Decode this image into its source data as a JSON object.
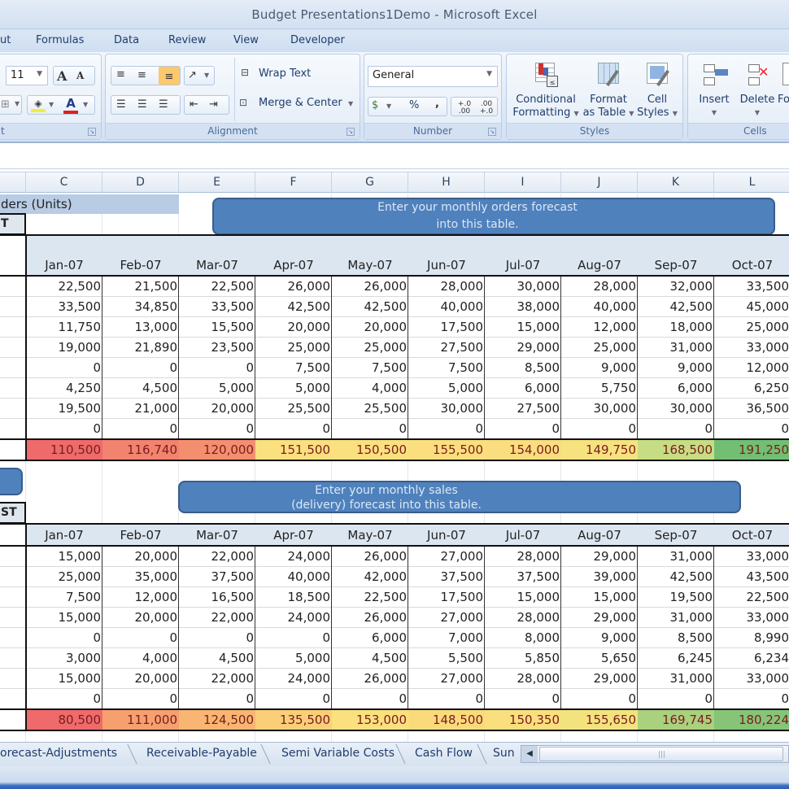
{
  "window": {
    "title": "Budget Presentations1Demo - Microsoft Excel"
  },
  "menu": {
    "tabs": [
      {
        "label": "ut"
      },
      {
        "label": "Formulas"
      },
      {
        "label": "Data"
      },
      {
        "label": "Review"
      },
      {
        "label": "View"
      },
      {
        "label": "Developer"
      }
    ]
  },
  "ribbon": {
    "font": {
      "size_value": "11",
      "group_label_partial": "t",
      "grow_icon": "A",
      "shrink_icon": "A",
      "font_color_icon": "A"
    },
    "alignment": {
      "group_label": "Alignment",
      "wrap_text": "Wrap Text",
      "merge_center": "Merge & Center"
    },
    "number": {
      "group_label": "Number",
      "format_value": "General",
      "percent": "%",
      "comma": ",",
      "inc_decimal": "+.0 .00",
      "dec_decimal": ".00 +.0"
    },
    "styles": {
      "group_label": "Styles",
      "conditional_formatting": [
        "Conditional",
        "Formatting"
      ],
      "format_as_table": [
        "Format",
        "as Table"
      ],
      "cell_styles": [
        "Cell",
        "Styles"
      ]
    },
    "cells": {
      "group_label": "Cells",
      "insert": "Insert",
      "delete": "Delete",
      "format_partial": "Fo"
    }
  },
  "columns": [
    "C",
    "D",
    "E",
    "F",
    "G",
    "H",
    "I",
    "J",
    "K",
    "L"
  ],
  "orders": {
    "title_partial": "ders (Units)",
    "tag_partial": "T",
    "callout": [
      "Enter your monthly  orders forecast",
      "into this table."
    ],
    "months": [
      "Jan-07",
      "Feb-07",
      "Mar-07",
      "Apr-07",
      "May-07",
      "Jun-07",
      "Jul-07",
      "Aug-07",
      "Sep-07",
      "Oct-07"
    ],
    "rows": [
      [
        "22,500",
        "21,500",
        "22,500",
        "26,000",
        "26,000",
        "28,000",
        "30,000",
        "28,000",
        "32,000",
        "33,500"
      ],
      [
        "33,500",
        "34,850",
        "33,500",
        "42,500",
        "42,500",
        "40,000",
        "38,000",
        "40,000",
        "42,500",
        "45,000"
      ],
      [
        "11,750",
        "13,000",
        "15,500",
        "20,000",
        "20,000",
        "17,500",
        "15,000",
        "12,000",
        "18,000",
        "25,000"
      ],
      [
        "19,000",
        "21,890",
        "23,500",
        "25,000",
        "25,000",
        "27,500",
        "29,000",
        "25,000",
        "31,000",
        "33,000"
      ],
      [
        "0",
        "0",
        "0",
        "7,500",
        "7,500",
        "7,500",
        "8,500",
        "9,000",
        "9,000",
        "12,000"
      ],
      [
        "4,250",
        "4,500",
        "5,000",
        "5,000",
        "4,000",
        "5,000",
        "6,000",
        "5,750",
        "6,000",
        "6,250"
      ],
      [
        "19,500",
        "21,000",
        "20,000",
        "25,500",
        "25,500",
        "30,000",
        "27,500",
        "30,000",
        "30,000",
        "36,500"
      ],
      [
        "0",
        "0",
        "0",
        "0",
        "0",
        "0",
        "0",
        "0",
        "0",
        "0"
      ]
    ],
    "totals": [
      "110,500",
      "116,740",
      "120,000",
      "151,500",
      "150,500",
      "155,500",
      "154,000",
      "149,750",
      "168,500",
      "191,250"
    ],
    "total_colors": [
      "#ef6a6b",
      "#f2836e",
      "#f38f6f",
      "#fbe07f",
      "#fbe07f",
      "#fbdf7e",
      "#fadd7f",
      "#f7e280",
      "#c7dd83",
      "#72bf73"
    ],
    "total_text_color": "#7a1d1d"
  },
  "sales": {
    "tag_partial": "ST",
    "callout": [
      "Enter your monthly sales",
      "(delivery) forecast into this table."
    ],
    "months": [
      "Jan-07",
      "Feb-07",
      "Mar-07",
      "Apr-07",
      "May-07",
      "Jun-07",
      "Jul-07",
      "Aug-07",
      "Sep-07",
      "Oct-07"
    ],
    "rows": [
      [
        "15,000",
        "20,000",
        "22,000",
        "24,000",
        "26,000",
        "27,000",
        "28,000",
        "29,000",
        "31,000",
        "33,000"
      ],
      [
        "25,000",
        "35,000",
        "37,500",
        "40,000",
        "42,000",
        "37,500",
        "37,500",
        "39,000",
        "42,500",
        "43,500"
      ],
      [
        "7,500",
        "12,000",
        "16,500",
        "18,500",
        "22,500",
        "17,500",
        "15,000",
        "15,000",
        "19,500",
        "22,500"
      ],
      [
        "15,000",
        "20,000",
        "22,000",
        "24,000",
        "26,000",
        "27,000",
        "28,000",
        "29,000",
        "31,000",
        "33,000"
      ],
      [
        "0",
        "0",
        "0",
        "0",
        "6,000",
        "7,000",
        "8,000",
        "9,000",
        "8,500",
        "8,990"
      ],
      [
        "3,000",
        "4,000",
        "4,500",
        "5,000",
        "4,500",
        "5,500",
        "5,850",
        "5,650",
        "6,245",
        "6,234"
      ],
      [
        "15,000",
        "20,000",
        "22,000",
        "24,000",
        "26,000",
        "27,000",
        "28,000",
        "29,000",
        "31,000",
        "33,000"
      ],
      [
        "0",
        "0",
        "0",
        "0",
        "0",
        "0",
        "0",
        "0",
        "0",
        "0"
      ]
    ],
    "totals": [
      "80,500",
      "111,000",
      "124,500",
      "135,500",
      "153,000",
      "148,500",
      "150,350",
      "155,650",
      "169,745",
      "180,224"
    ],
    "total_colors": [
      "#ef6a6b",
      "#f6a06f",
      "#f8b672",
      "#fbcf78",
      "#fbe07f",
      "#fadb7c",
      "#fadf7e",
      "#f3e37f",
      "#a9d17e",
      "#86c578"
    ]
  },
  "sheet_tabs": [
    {
      "label": "orecast-Adjustments"
    },
    {
      "label": "Receivable-Payable"
    },
    {
      "label": "Semi Variable Costs"
    },
    {
      "label": "Cash Flow"
    },
    {
      "label": "Sun"
    }
  ]
}
